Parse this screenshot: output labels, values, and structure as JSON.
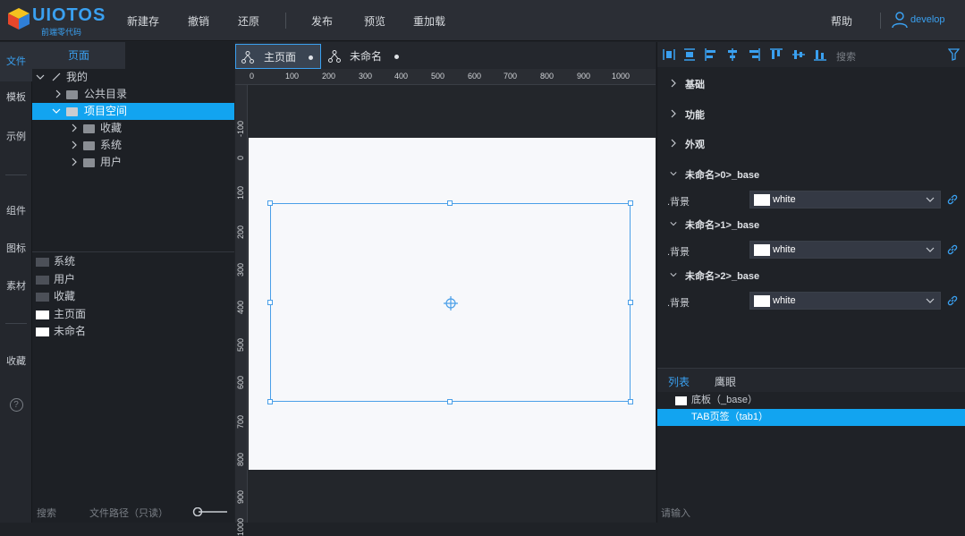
{
  "app": {
    "logo_text": "UIOTOS",
    "logo_sub": "前端零代码"
  },
  "toolbar": {
    "items": [
      "新建存",
      "撤销",
      "还原",
      "发布",
      "预览",
      "重加载"
    ],
    "help": "帮助",
    "user": "develop"
  },
  "leftnav": {
    "items": [
      "文件",
      "模板",
      "示例",
      "组件",
      "图标",
      "素材",
      "收藏",
      "?"
    ]
  },
  "filepanel": {
    "tab": "页面",
    "tree": [
      {
        "label": "我的",
        "depth": 0,
        "open": true,
        "kind": "link"
      },
      {
        "label": "公共目录",
        "depth": 1,
        "open": false,
        "kind": "folder"
      },
      {
        "label": "项目空间",
        "depth": 1,
        "open": true,
        "kind": "folder-light",
        "selected": true
      },
      {
        "label": "收藏",
        "depth": 2,
        "open": false,
        "kind": "folder"
      },
      {
        "label": "系统",
        "depth": 2,
        "open": false,
        "kind": "folder"
      },
      {
        "label": "用户",
        "depth": 2,
        "open": false,
        "kind": "folder"
      }
    ],
    "list": [
      {
        "label": "系统",
        "icon": "dark"
      },
      {
        "label": "用户",
        "icon": "dark"
      },
      {
        "label": "收藏",
        "icon": "dark"
      },
      {
        "label": "主页面",
        "icon": "white"
      },
      {
        "label": "未命名",
        "icon": "white"
      }
    ],
    "search_placeholder": "搜索",
    "path_label": "文件路径（只读）"
  },
  "editor": {
    "tabs": [
      {
        "label": "主页面",
        "active": true
      },
      {
        "label": "未命名",
        "active": false
      }
    ],
    "ruler_h": [
      "0",
      "100",
      "200",
      "300",
      "400",
      "500",
      "600",
      "700",
      "800",
      "900",
      "1000"
    ],
    "ruler_v": [
      "-100",
      "0",
      "100",
      "200",
      "300",
      "400",
      "500",
      "600",
      "700",
      "800",
      "900",
      "1000"
    ]
  },
  "props": {
    "search_placeholder": "搜索",
    "sections": [
      "基础",
      "功能",
      "外观"
    ],
    "groups": [
      {
        "title": "未命名>0>_base",
        "prop": ".背景",
        "value": "white"
      },
      {
        "title": "未命名>1>_base",
        "prop": ".背景",
        "value": "white"
      },
      {
        "title": "未命名>2>_base",
        "prop": ".背景",
        "value": "white"
      }
    ],
    "list_tabs": [
      "列表",
      "鹰眼"
    ],
    "list_items": [
      {
        "label": "底板（_base）",
        "selected": false
      },
      {
        "label": "TAB页签（tab1）",
        "selected": true
      }
    ],
    "input_placeholder": "请输入"
  }
}
